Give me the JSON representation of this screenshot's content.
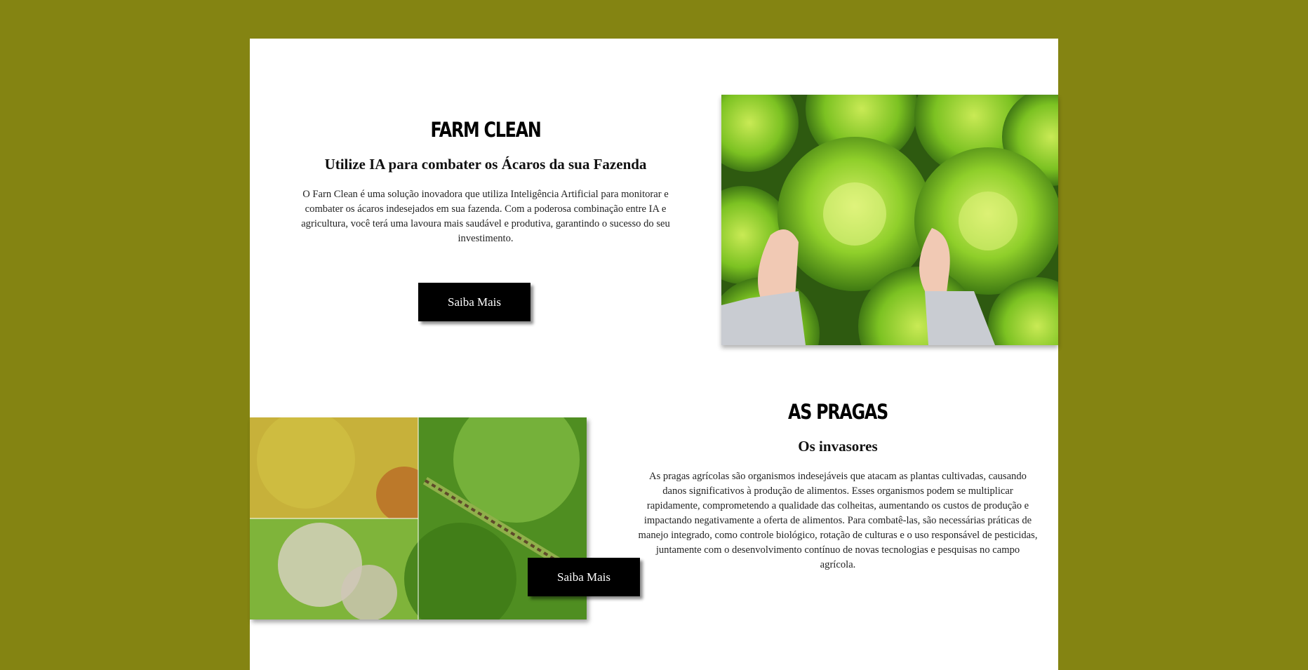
{
  "hero": {
    "title": "FARM CLEAN",
    "subtitle": "Utilize IA para combater os Ácaros da sua Fazenda",
    "description": "O Farn Clean é uma solução inovadora que utiliza Inteligência Artificial para monitorar e combater os ácaros indesejados em sua fazenda. Com a poderosa combinação entre IA e agricultura, você terá uma lavoura mais saudável e produtiva, garantindo o sucesso do seu investimento.",
    "button_label": "Saiba Mais",
    "image_icon": "lettuce-hands-photo"
  },
  "pests": {
    "title": "AS PRAGAS",
    "subtitle": "Os invasores",
    "description": "As pragas agrícolas são organismos indesejáveis que atacam as plantas cultivadas, causando danos significativos à produção de alimentos. Esses organismos podem se multiplicar rapidamente, comprometendo a qualidade das colheitas, aumentando os custos de produção e impactando negativamente a oferta de alimentos. Para combatê-las, são necessárias práticas de manejo integrado, como controle biológico, rotação de culturas e o uso responsável de pesticidas, juntamente com o desenvolvimento contínuo de novas tecnologias e pesquisas no campo agrícola.",
    "button_label": "Saiba Mais",
    "image_icon": "pest-damage-collage-photo"
  },
  "colors": {
    "page_background": "#848412",
    "card_background": "#ffffff",
    "button_background": "#000000",
    "button_text": "#ffffff"
  }
}
